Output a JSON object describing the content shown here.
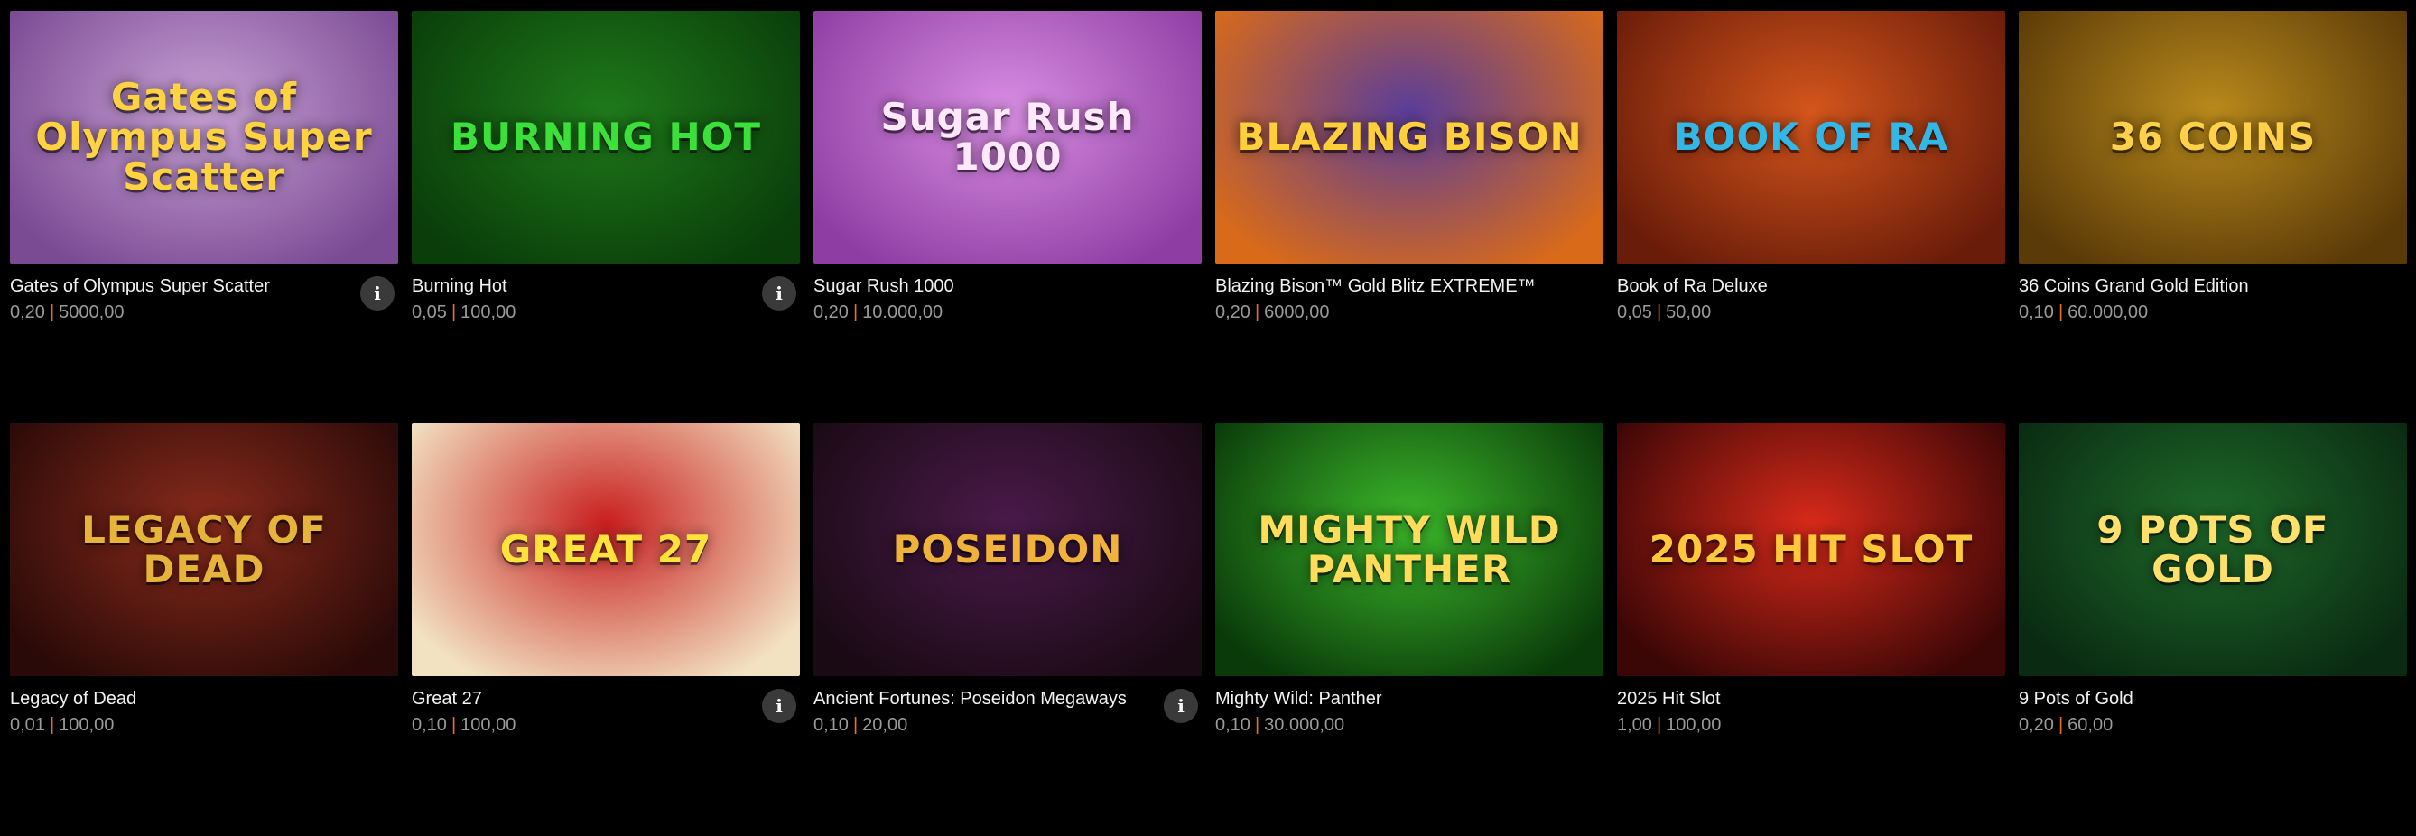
{
  "games": [
    {
      "title": "Gates of Olympus Super Scatter",
      "min": "0,20",
      "max": "5000,00",
      "art": "Gates of Olympus Super Scatter",
      "bg1": "#c9a3d6",
      "bg2": "#7a4a93",
      "fg": "#ffd23f",
      "info": true
    },
    {
      "title": "Burning Hot",
      "min": "0,05",
      "max": "100,00",
      "art": "BURNING HOT",
      "bg1": "#1f7a1b",
      "bg2": "#0a3d0a",
      "fg": "#3ce03a",
      "info": true
    },
    {
      "title": "Sugar Rush 1000",
      "min": "0,20",
      "max": "10.000,00",
      "art": "Sugar Rush 1000",
      "bg1": "#d98ee3",
      "bg2": "#8e3ea3",
      "fg": "#ffe8fb",
      "info": false
    },
    {
      "title": "Blazing Bison™ Gold Blitz EXTREME™",
      "min": "0,20",
      "max": "6000,00",
      "art": "BLAZING BISON",
      "bg1": "#5a3d9a",
      "bg2": "#d86a1a",
      "fg": "#ffcf3a",
      "info": false
    },
    {
      "title": "Book of Ra Deluxe",
      "min": "0,05",
      "max": "50,00",
      "art": "BOOK OF RA",
      "bg1": "#d4561c",
      "bg2": "#6a1c0a",
      "fg": "#33b7e6",
      "info": false
    },
    {
      "title": "36 Coins Grand Gold Edition",
      "min": "0,10",
      "max": "60.000,00",
      "art": "36 COINS",
      "bg1": "#b98a1c",
      "bg2": "#5a3a08",
      "fg": "#ffd04a",
      "info": false
    },
    {
      "title": "Legacy of Dead",
      "min": "0,01",
      "max": "100,00",
      "art": "LEGACY OF DEAD",
      "bg1": "#8a2b1c",
      "bg2": "#2a0a08",
      "fg": "#e6b43a",
      "info": false
    },
    {
      "title": "Great 27",
      "min": "0,10",
      "max": "100,00",
      "art": "GREAT 27",
      "bg1": "#c81e1e",
      "bg2": "#f2e2c2",
      "fg": "#ffe23a",
      "info": true
    },
    {
      "title": "Ancient Fortunes: Poseidon Megaways",
      "min": "0,10",
      "max": "20,00",
      "art": "POSEIDON",
      "bg1": "#4a1a4a",
      "bg2": "#1a0a14",
      "fg": "#f0b23a",
      "info": true
    },
    {
      "title": "Mighty Wild: Panther",
      "min": "0,10",
      "max": "30.000,00",
      "art": "MIGHTY WILD PANTHER",
      "bg1": "#3cb82a",
      "bg2": "#0a3a0a",
      "fg": "#ffdc5a",
      "info": false
    },
    {
      "title": "2025 Hit Slot",
      "min": "1,00",
      "max": "100,00",
      "art": "2025 HIT SLOT",
      "bg1": "#d82a1a",
      "bg2": "#3a0606",
      "fg": "#ffc83a",
      "info": false
    },
    {
      "title": "9 Pots of Gold",
      "min": "0,20",
      "max": "60,00",
      "art": "9 POTS OF GOLD",
      "bg1": "#1f6a2a",
      "bg2": "#0a2a12",
      "fg": "#ffe06a",
      "info": false
    }
  ],
  "info_label": "i"
}
